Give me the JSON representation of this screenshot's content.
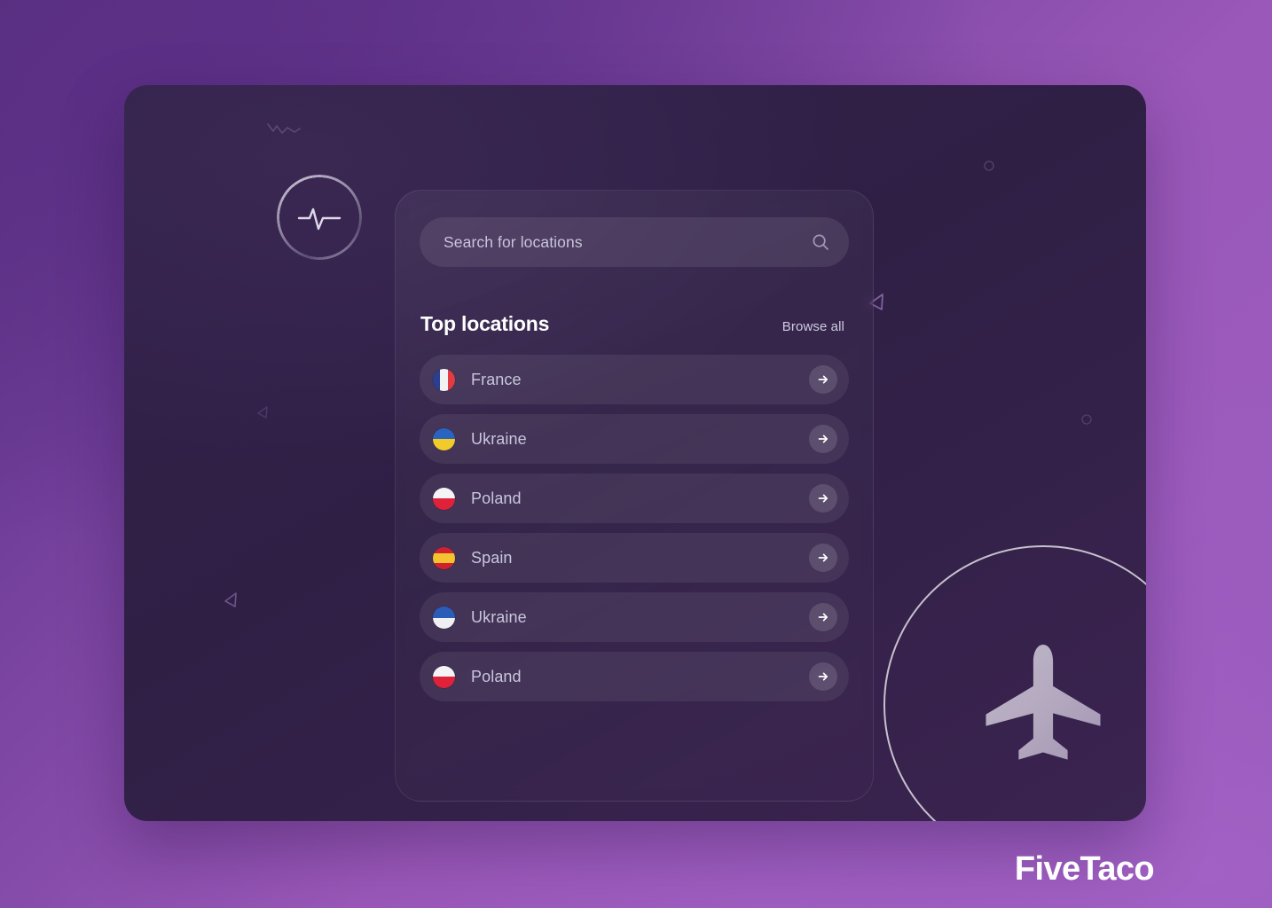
{
  "brand": {
    "name": "FiveTaco"
  },
  "badge": {
    "icon": "activity-pulse-icon"
  },
  "search": {
    "placeholder": "Search for locations",
    "value": "",
    "icon": "search-icon"
  },
  "section": {
    "title": "Top locations",
    "browse_all_label": "Browse all"
  },
  "locations": [
    {
      "name": "France",
      "flag": "flag-france",
      "action_icon": "arrow-right-icon"
    },
    {
      "name": "Ukraine",
      "flag": "flag-ukraine",
      "action_icon": "arrow-right-icon"
    },
    {
      "name": "Poland",
      "flag": "flag-poland",
      "action_icon": "arrow-right-icon"
    },
    {
      "name": "Spain",
      "flag": "flag-spain",
      "action_icon": "arrow-right-icon"
    },
    {
      "name": "Ukraine",
      "flag": "flag-ukraine-alt",
      "action_icon": "arrow-right-icon"
    },
    {
      "name": "Poland",
      "flag": "flag-poland",
      "action_icon": "arrow-right-icon"
    }
  ],
  "decoration": {
    "airplane_icon": "airplane-icon",
    "shapes": [
      "triangle-outline",
      "triangle-outline",
      "triangle-outline",
      "zigzag-line",
      "circle-outline"
    ]
  },
  "colors": {
    "bg_purple_dark": "#55307c",
    "bg_purple_light": "#9a58b8",
    "panel": "#2f1f45",
    "row": "#3b3752",
    "text_primary": "#ffffff",
    "text_muted": "#c9c6dd",
    "france_blue": "#2a3f8f",
    "france_red": "#e23b42",
    "ukraine_blue": "#2a63c0",
    "ukraine_yellow": "#f2cb2a",
    "poland_red": "#e0213a",
    "spain_red": "#d0212f",
    "spain_yellow": "#f4c430"
  }
}
